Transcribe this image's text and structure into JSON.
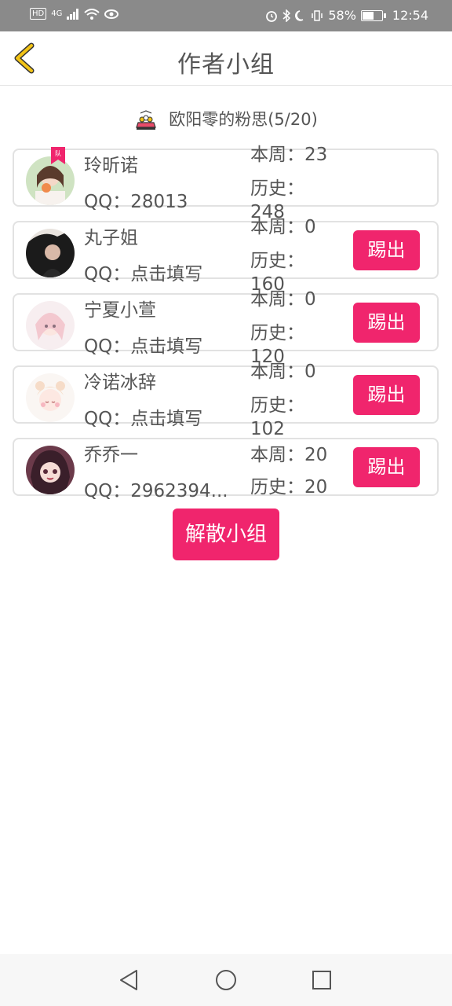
{
  "status_bar": {
    "network": "4G",
    "battery": "58%",
    "time": "12:54"
  },
  "header": {
    "title": "作者小组"
  },
  "group": {
    "label": "欧阳零的粉思(5/20)"
  },
  "members": [
    {
      "name": "玲昕诺",
      "qq": "QQ：28013",
      "week": "本周：23",
      "history": "历史：248",
      "is_leader": true
    },
    {
      "name": "丸子姐",
      "qq": "QQ：点击填写",
      "week": "本周：0",
      "history": "历史：160",
      "kick_label": "踢出"
    },
    {
      "name": "宁夏小萱",
      "qq": "QQ：点击填写",
      "week": "本周：0",
      "history": "历史：120",
      "kick_label": "踢出"
    },
    {
      "name": "冷诺冰辞",
      "qq": "QQ：点击填写",
      "week": "本周：0",
      "history": "历史：102",
      "kick_label": "踢出"
    },
    {
      "name": "乔乔一",
      "qq": "QQ：2962394...",
      "week": "本周：20",
      "history": "历史：20",
      "kick_label": "踢出"
    }
  ],
  "disband_label": "解散小组",
  "colors": {
    "accent": "#f0256d",
    "back_arrow": "#f2c316",
    "status_bar": "#8a8a8a"
  }
}
